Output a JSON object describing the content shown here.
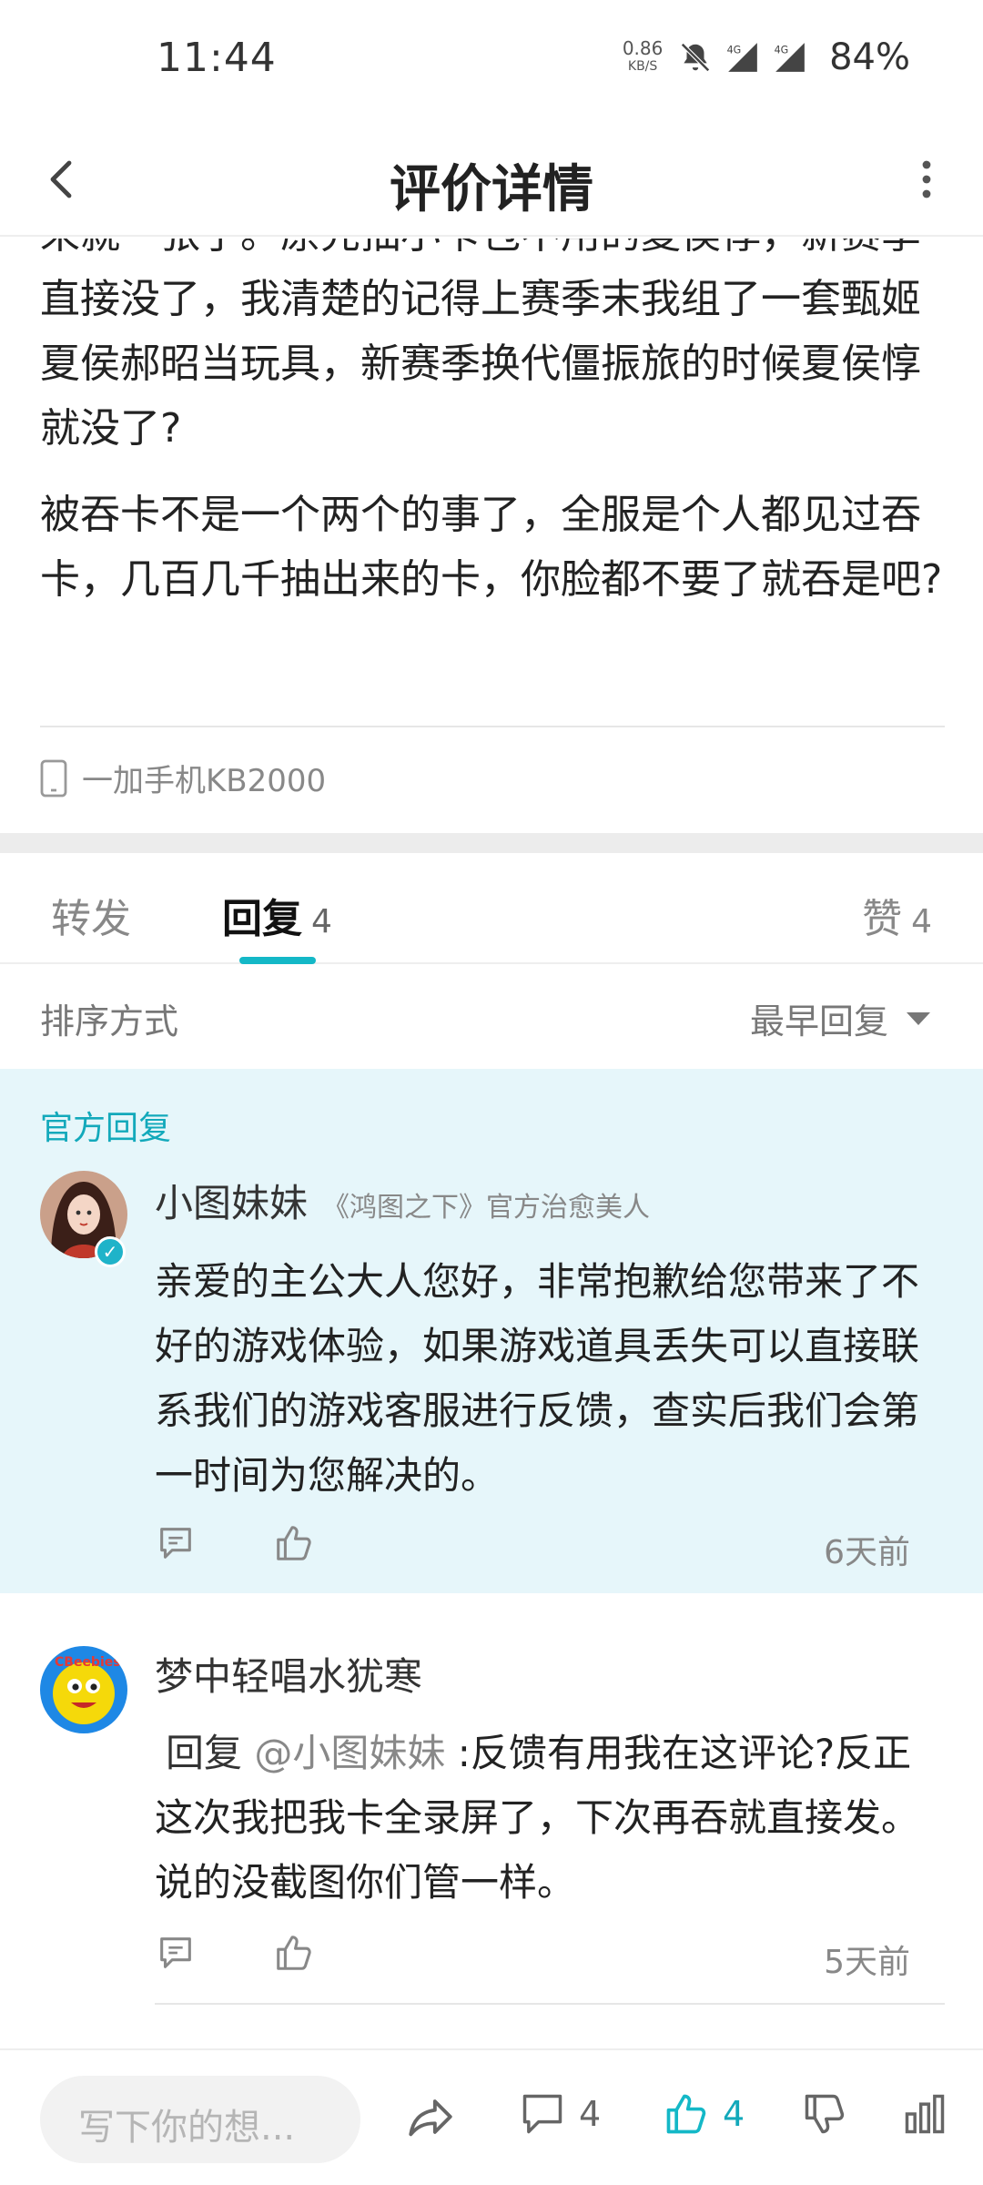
{
  "status_bar": {
    "time": "11:44",
    "net_speed_value": "0.86",
    "net_speed_unit": "KB/S",
    "network_1": "4G",
    "network_2": "4G",
    "battery": "84%"
  },
  "header": {
    "title": "评价详情"
  },
  "article": {
    "paragraphs": [
      "来就一张了。原先抽小卡包不用的夏侯惇，新赛季直接没了，我清楚的记得上赛季末我组了一套甄姬夏侯郝昭当玩具，新赛季换代僵振旅的时候夏侯惇就没了?",
      "被吞卡不是一个两个的事了，全服是个人都见过吞卡，几百几千抽出来的卡，你脸都不要了就吞是吧?"
    ],
    "device": "一加手机KB2000"
  },
  "tabs": {
    "forward": "转发",
    "reply": "回复",
    "reply_count": "4",
    "like": "赞",
    "like_count": "4"
  },
  "sort": {
    "label": "排序方式",
    "selected": "最早回复"
  },
  "official_reply": {
    "tag": "官方回复",
    "author": "小图妹妹",
    "author_title": "《鸿图之下》官方治愈美人",
    "text": "亲爱的主公大人您好，非常抱歉给您带来了不好的游戏体验，如果游戏道具丢失可以直接联系我们的游戏客服进行反馈，查实后我们会第一时间为您解决的。",
    "time": "6天前"
  },
  "comment2": {
    "author": "梦中轻唱水犹寒",
    "reply_prefix": "回复",
    "mention": "@小图妹妹",
    "text": "  :反馈有用我在这评论?反正这次我把我卡全录屏了，下次再吞就直接发。说的没截图你们管一样。",
    "time": "5天前"
  },
  "bottom_bar": {
    "compose_placeholder": "写下你的想...",
    "comment_count": "4",
    "like_count": "4"
  },
  "colors": {
    "accent": "#14b8c7",
    "official_bg": "#e6f6fa"
  }
}
